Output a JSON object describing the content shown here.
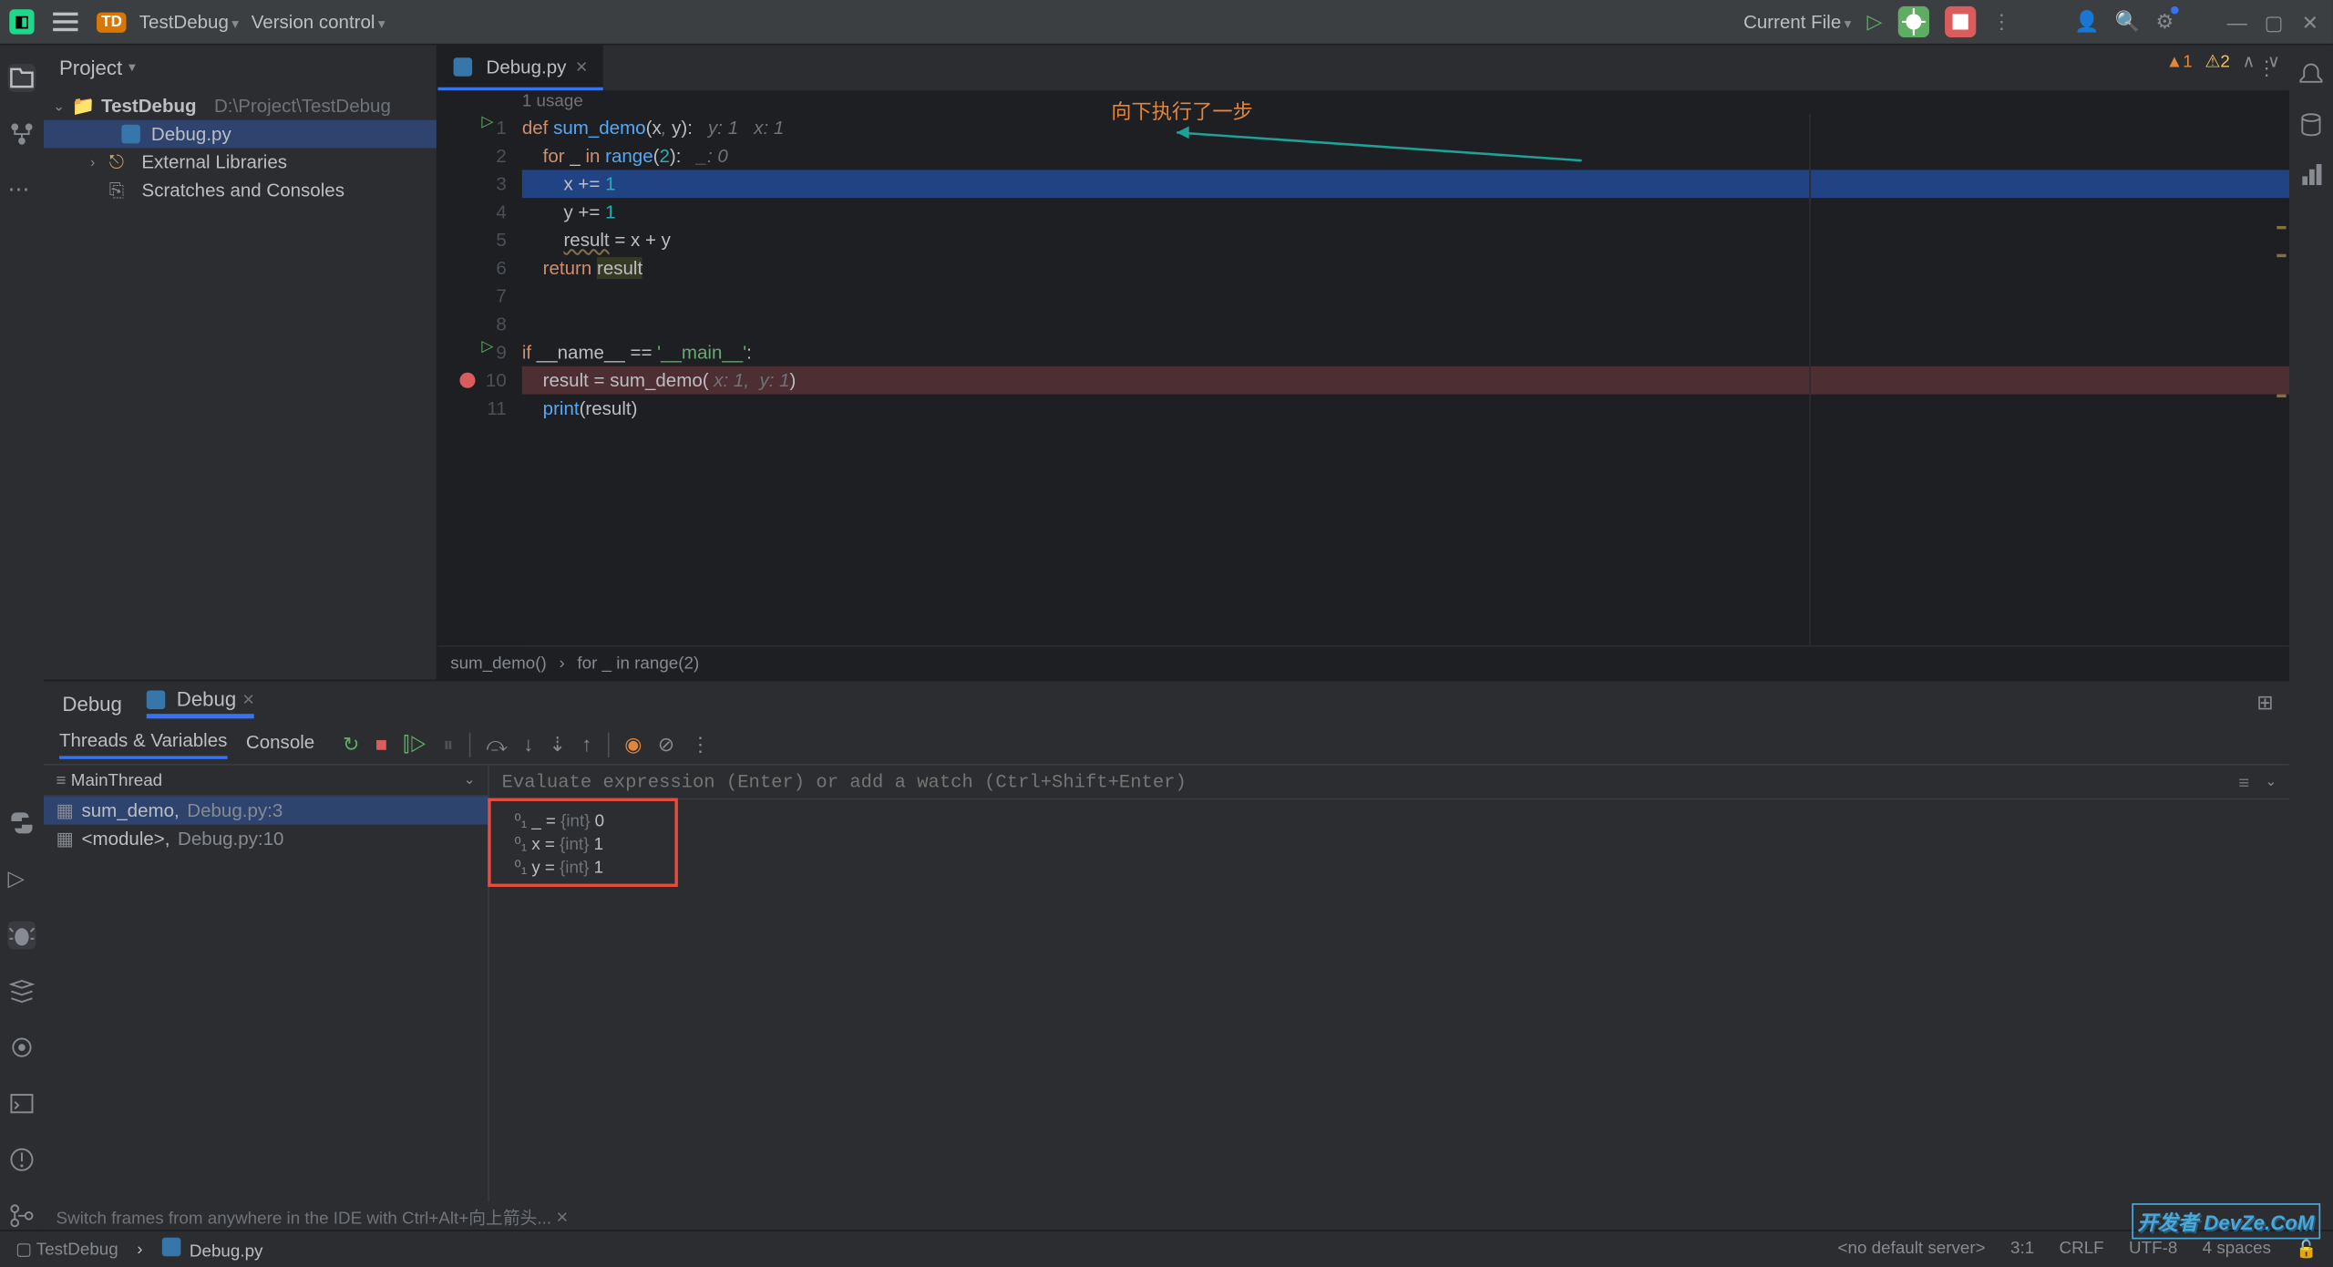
{
  "topbar": {
    "project_badge": "TD",
    "project_name": "TestDebug",
    "vcs_label": "Version control",
    "run_config": "Current File"
  },
  "project_tree": {
    "header": "Project",
    "root_name": "TestDebug",
    "root_path": "D:\\Project\\TestDebug",
    "file1": "Debug.py",
    "ext_lib": "External Libraries",
    "scratches": "Scratches and Consoles"
  },
  "editor": {
    "tab_name": "Debug.py",
    "usage_hint": "1 usage",
    "warn_count": "1",
    "err_count": "2",
    "annotation": "向下执行了一步",
    "hints": {
      "y": "y: 1",
      "x": "x: 1",
      "underscore": "_: 0",
      "call_x": "x: 1,",
      "call_y": "y: 1"
    },
    "breadcrumb1": "sum_demo()",
    "breadcrumb2": "for _ in range(2)"
  },
  "debug": {
    "tab_label": "Debug",
    "config_name": "Debug",
    "subtab_threads": "Threads & Variables",
    "subtab_console": "Console",
    "thread_name": "MainThread",
    "frame1_fn": "sum_demo,",
    "frame1_loc": "Debug.py:3",
    "frame2_fn": "<module>,",
    "frame2_loc": "Debug.py:10",
    "eval_placeholder": "Evaluate expression (Enter) or add a watch (Ctrl+Shift+Enter)",
    "vars": [
      {
        "name": "_",
        "type": "{int}",
        "value": "0"
      },
      {
        "name": "x",
        "type": "{int}",
        "value": "1"
      },
      {
        "name": "y",
        "type": "{int}",
        "value": "1"
      }
    ],
    "hint_text": "Switch frames from anywhere in the IDE with Ctrl+Alt+向上箭头..."
  },
  "status": {
    "project": "TestDebug",
    "file": "Debug.py",
    "server": "<no default server>",
    "caret": "3:1",
    "line_sep": "CRLF",
    "encoding": "UTF-8",
    "indent": "4 spaces"
  },
  "watermark": "开发者\nDevZe.CoM"
}
